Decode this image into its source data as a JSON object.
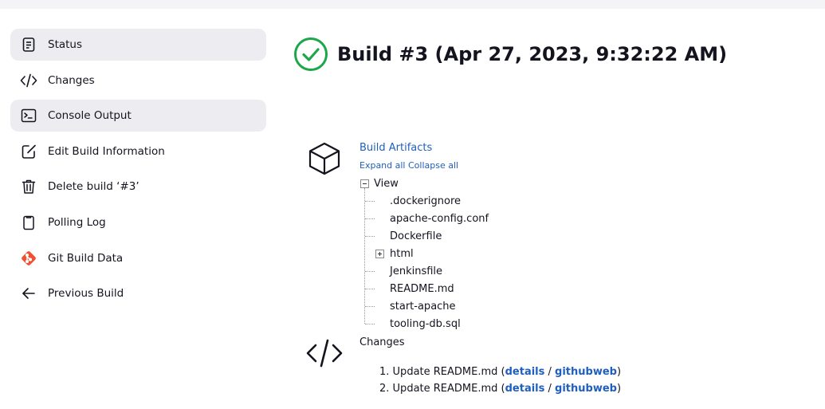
{
  "sidebar": {
    "items": [
      {
        "label": "Status",
        "icon": "document-icon",
        "active": true
      },
      {
        "label": "Changes",
        "icon": "code-icon",
        "active": false
      },
      {
        "label": "Console Output",
        "icon": "terminal-icon",
        "active": true
      },
      {
        "label": "Edit Build Information",
        "icon": "edit-icon",
        "active": false
      },
      {
        "label": "Delete build ‘#3’",
        "icon": "trash-icon",
        "active": false
      },
      {
        "label": "Polling Log",
        "icon": "clipboard-icon",
        "active": false
      },
      {
        "label": "Git Build Data",
        "icon": "git-icon",
        "active": false
      },
      {
        "label": "Previous Build",
        "icon": "arrow-left-icon",
        "active": false
      }
    ]
  },
  "main": {
    "title": "Build #3 (Apr 27, 2023, 9:32:22 AM)",
    "status_icon": "success-check-icon",
    "status_color": "#1ea64b",
    "artifacts": {
      "title": "Build Artifacts",
      "expand_all": "Expand all",
      "collapse_all": "Collapse all",
      "root": "View",
      "files": [
        {
          "name": ".dockerignore",
          "expandable": false
        },
        {
          "name": "apache-config.conf",
          "expandable": false
        },
        {
          "name": "Dockerfile",
          "expandable": false
        },
        {
          "name": "html",
          "expandable": true
        },
        {
          "name": "Jenkinsfile",
          "expandable": false
        },
        {
          "name": "README.md",
          "expandable": false
        },
        {
          "name": "start-apache",
          "expandable": false
        },
        {
          "name": "tooling-db.sql",
          "expandable": false
        }
      ]
    },
    "changes": {
      "title": "Changes",
      "items": [
        {
          "number": "1.",
          "text": "Update README.md",
          "details": "details",
          "githubweb": "githubweb"
        },
        {
          "number": "2.",
          "text": "Update README.md",
          "details": "details",
          "githubweb": "githubweb"
        }
      ]
    }
  },
  "colors": {
    "link": "#1f5fbf",
    "git_brand": "#f05133",
    "active_bg": "#ececf1"
  }
}
